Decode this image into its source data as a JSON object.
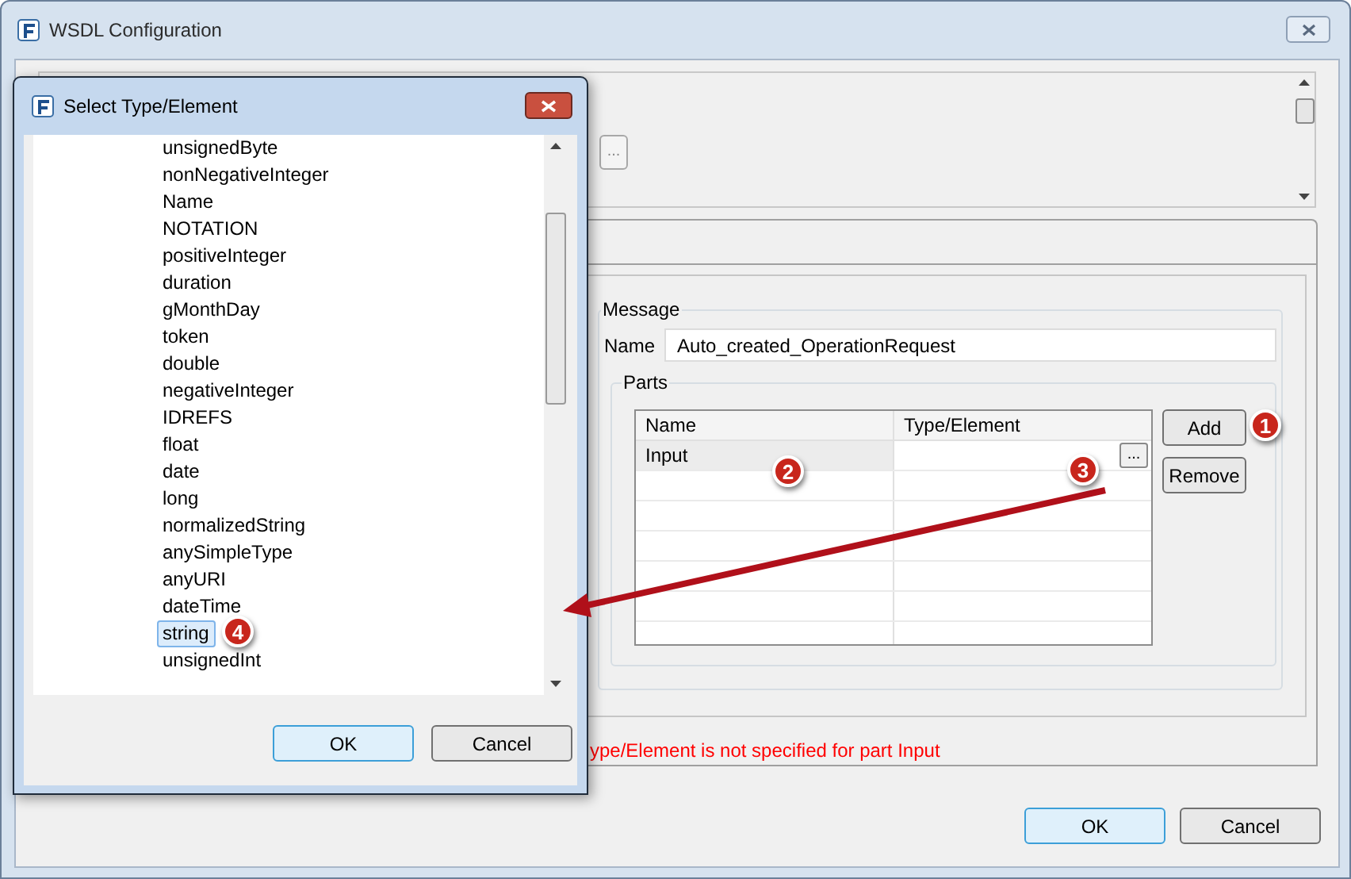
{
  "window": {
    "title": "WSDL Configuration"
  },
  "top_panel": {
    "browse_button": "..."
  },
  "message": {
    "group_label": "Message",
    "name_label": "Name",
    "name_value": "Auto_created_OperationRequest",
    "parts": {
      "group_label": "Parts",
      "columns": [
        "Name",
        "Type/Element"
      ],
      "rows": [
        {
          "name": "Input",
          "selected": true,
          "browse_button": "..."
        }
      ],
      "buttons": [
        "Add",
        "Remove"
      ]
    }
  },
  "error": "ype/Element is not specified for part Input",
  "buttons": [
    "OK",
    "Cancel"
  ],
  "dialog": {
    "title": "Select Type/Element",
    "items": [
      {
        "label": "unsignedByte",
        "selected": false
      },
      {
        "label": "nonNegativeInteger",
        "selected": false
      },
      {
        "label": "Name",
        "selected": false
      },
      {
        "label": "NOTATION",
        "selected": false
      },
      {
        "label": "positiveInteger",
        "selected": false
      },
      {
        "label": "duration",
        "selected": false
      },
      {
        "label": "gMonthDay",
        "selected": false
      },
      {
        "label": "token",
        "selected": false
      },
      {
        "label": "double",
        "selected": false
      },
      {
        "label": "negativeInteger",
        "selected": false
      },
      {
        "label": "IDREFS",
        "selected": false
      },
      {
        "label": "float",
        "selected": false
      },
      {
        "label": "date",
        "selected": false
      },
      {
        "label": "long",
        "selected": false
      },
      {
        "label": "normalizedString",
        "selected": false
      },
      {
        "label": "anySimpleType",
        "selected": false
      },
      {
        "label": "anyURI",
        "selected": false
      },
      {
        "label": "dateTime",
        "selected": false
      },
      {
        "label": "string",
        "selected": true
      },
      {
        "label": "unsignedInt",
        "selected": false
      }
    ],
    "buttons": [
      "OK",
      "Cancel"
    ]
  },
  "callouts": [
    "1",
    "2",
    "3",
    "4"
  ]
}
